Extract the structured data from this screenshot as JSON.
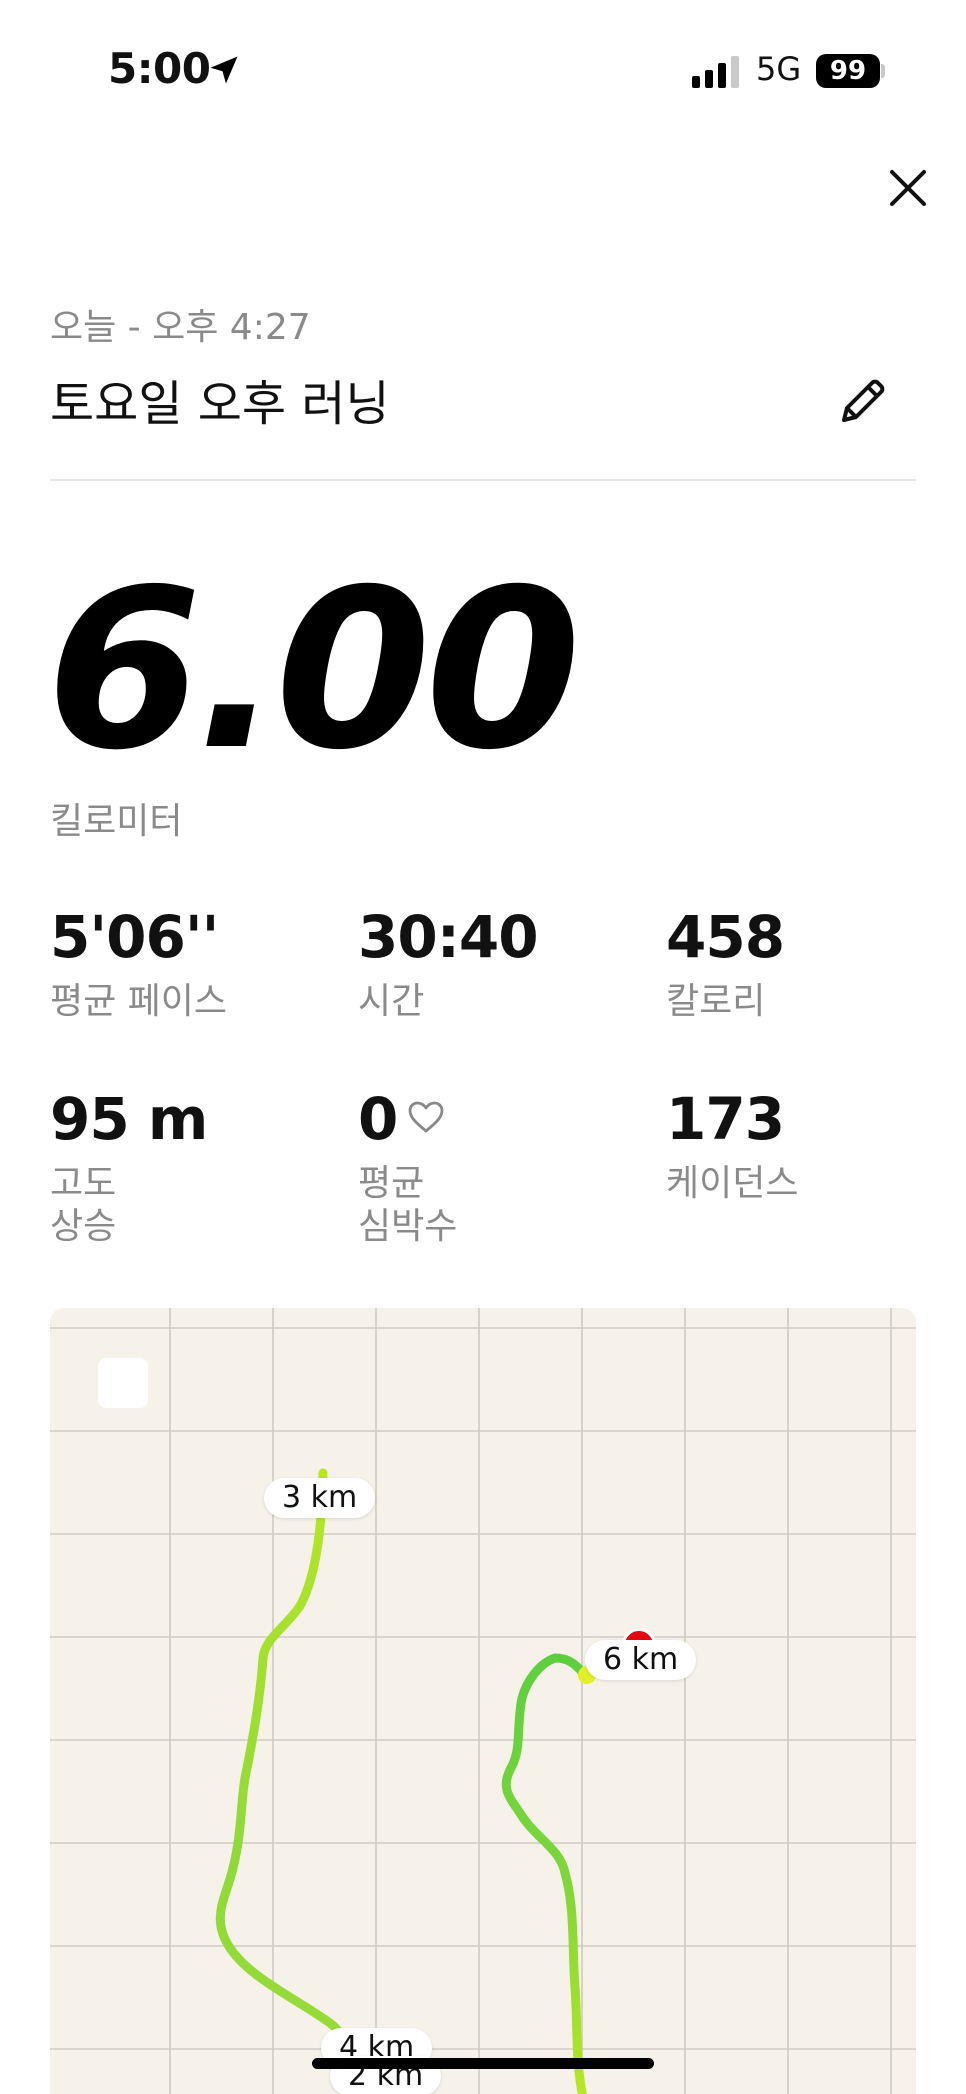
{
  "status_bar": {
    "time": "5:00",
    "network": "5G",
    "battery": "99",
    "icons": [
      "location-arrow-icon",
      "signal-bars-icon",
      "battery-icon"
    ]
  },
  "header": {
    "close_icon": "close-icon",
    "date": "오늘 - 오후 4:27",
    "title": "토요일 오후 러닝",
    "edit_icon": "pencil-icon"
  },
  "summary": {
    "distance": "6.00",
    "distance_unit": "킬로미터"
  },
  "stats": [
    {
      "value": "5'06''",
      "label": "평균 페이스"
    },
    {
      "value": "30:40",
      "label": "시간"
    },
    {
      "value": "458",
      "label": "칼로리"
    },
    {
      "value": "95 m",
      "label": "고도\n상승"
    },
    {
      "value": "0",
      "label": "평균\n심박수",
      "icon": "heart-outline-icon"
    },
    {
      "value": "173",
      "label": "케이던스"
    }
  ],
  "map": {
    "background": "#f6f2ea",
    "route_colors": [
      "#5fcf3a",
      "#a6e22e",
      "#d4ef1e"
    ],
    "end_pin_color": "#e30613",
    "km_markers": [
      "3 km",
      "6 km",
      "4 km",
      "2 km"
    ]
  }
}
